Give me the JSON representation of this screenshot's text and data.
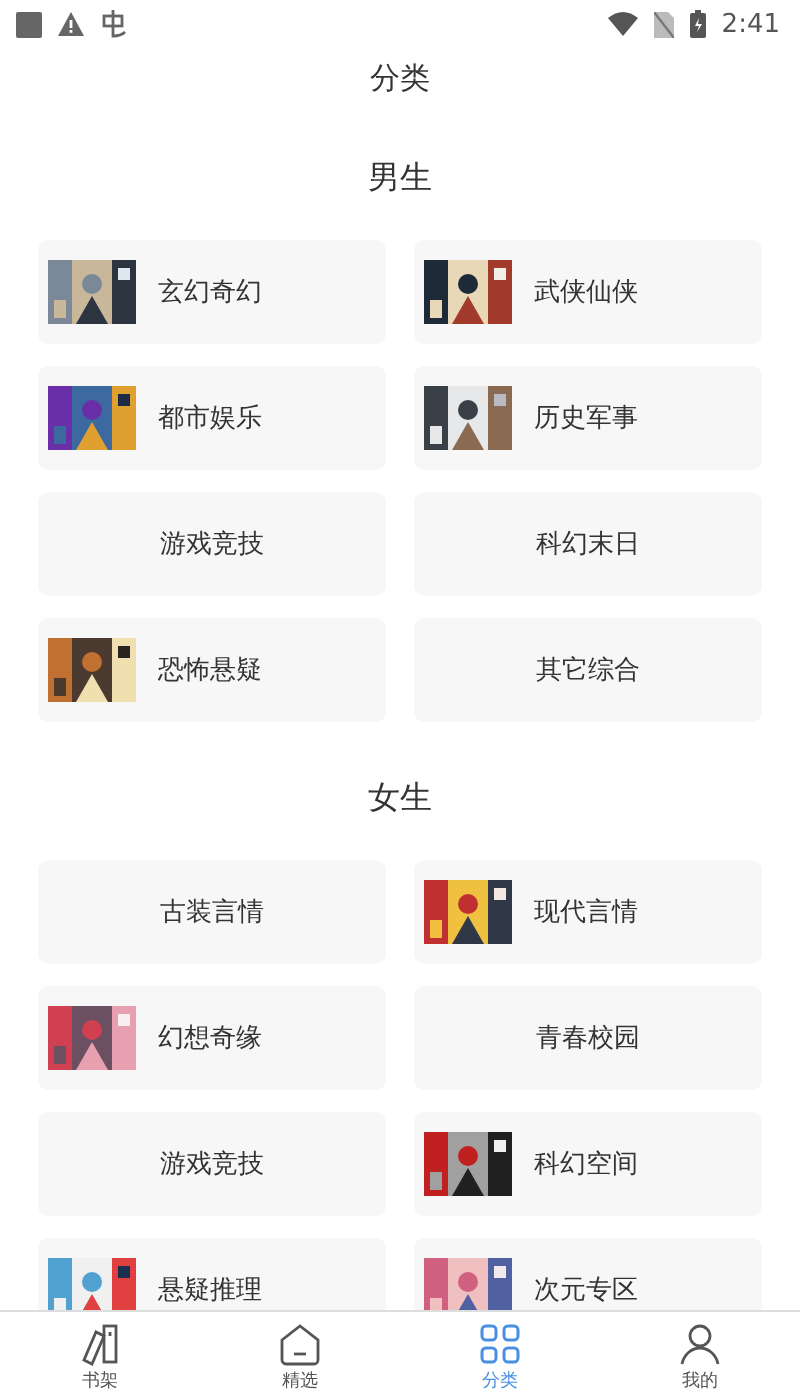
{
  "status_bar": {
    "time": "2:41"
  },
  "title": "分类",
  "sections": [
    {
      "heading": "男生",
      "categories": [
        {
          "label": "玄幻奇幻",
          "kind": "cover"
        },
        {
          "label": "武侠仙侠",
          "kind": "cover"
        },
        {
          "label": "都市娱乐",
          "kind": "cover"
        },
        {
          "label": "历史军事",
          "kind": "cover"
        },
        {
          "label": "游戏竞技",
          "kind": "plain"
        },
        {
          "label": "科幻末日",
          "kind": "plain"
        },
        {
          "label": "恐怖悬疑",
          "kind": "cover"
        },
        {
          "label": "其它综合",
          "kind": "plain"
        }
      ]
    },
    {
      "heading": "女生",
      "categories": [
        {
          "label": "古装言情",
          "kind": "plain"
        },
        {
          "label": "现代言情",
          "kind": "cover"
        },
        {
          "label": "幻想奇缘",
          "kind": "cover"
        },
        {
          "label": "青春校园",
          "kind": "plain"
        },
        {
          "label": "游戏竞技",
          "kind": "plain"
        },
        {
          "label": "科幻空间",
          "kind": "cover"
        },
        {
          "label": "悬疑推理",
          "kind": "cover"
        },
        {
          "label": "次元专区",
          "kind": "cover"
        }
      ]
    }
  ],
  "tabs": [
    {
      "label": "书架",
      "selected": false
    },
    {
      "label": "精选",
      "selected": false
    },
    {
      "label": "分类",
      "selected": true
    },
    {
      "label": "我的",
      "selected": false
    }
  ]
}
